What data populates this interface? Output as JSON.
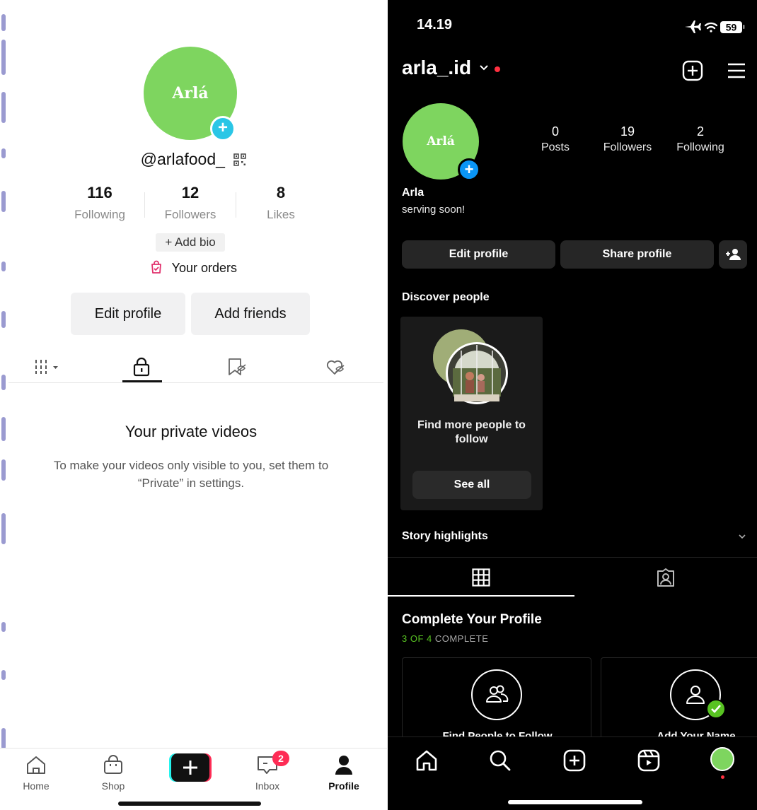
{
  "tiktok": {
    "avatar_text": "Arlá",
    "username": "@arlafood_",
    "stats": [
      {
        "value": "116",
        "label": "Following"
      },
      {
        "value": "12",
        "label": "Followers"
      },
      {
        "value": "8",
        "label": "Likes"
      }
    ],
    "add_bio_label": "+ Add bio",
    "orders_label": "Your orders",
    "edit_profile_label": "Edit profile",
    "add_friends_label": "Add friends",
    "tabs": [
      "videos-grid-icon",
      "lock-icon",
      "bookmark-icon",
      "heart-icon"
    ],
    "private_title": "Your private videos",
    "private_desc": "To make your videos only visible to you, set them to “Private” in settings.",
    "nav": {
      "home": "Home",
      "shop": "Shop",
      "inbox": "Inbox",
      "profile": "Profile",
      "inbox_badge": "2"
    },
    "colors": {
      "accent_cyan": "#2ac6e6",
      "accent_red": "#fe2c55",
      "avatar_green": "#7ed55f"
    }
  },
  "instagram": {
    "status_time": "14.19",
    "battery": "59",
    "handle": "arla_.id",
    "avatar_text": "Arlá",
    "stats": [
      {
        "value": "0",
        "label": "Posts"
      },
      {
        "value": "19",
        "label": "Followers"
      },
      {
        "value": "2",
        "label": "Following"
      }
    ],
    "name": "Arla",
    "bio": "serving soon!",
    "edit_profile_label": "Edit profile",
    "share_profile_label": "Share profile",
    "discover_title": "Discover people",
    "discover_card_text": "Find more people to follow",
    "see_all_label": "See all",
    "highlights_title": "Story highlights",
    "complete_title": "Complete Your Profile",
    "complete_progress": "3 OF 4",
    "complete_suffix": " COMPLETE",
    "profile_cards": [
      "Find People to Follow",
      "Add Your Name"
    ],
    "colors": {
      "accent_blue": "#0a95f6",
      "success_green": "#58c322",
      "notify_red": "#ff3040"
    }
  }
}
